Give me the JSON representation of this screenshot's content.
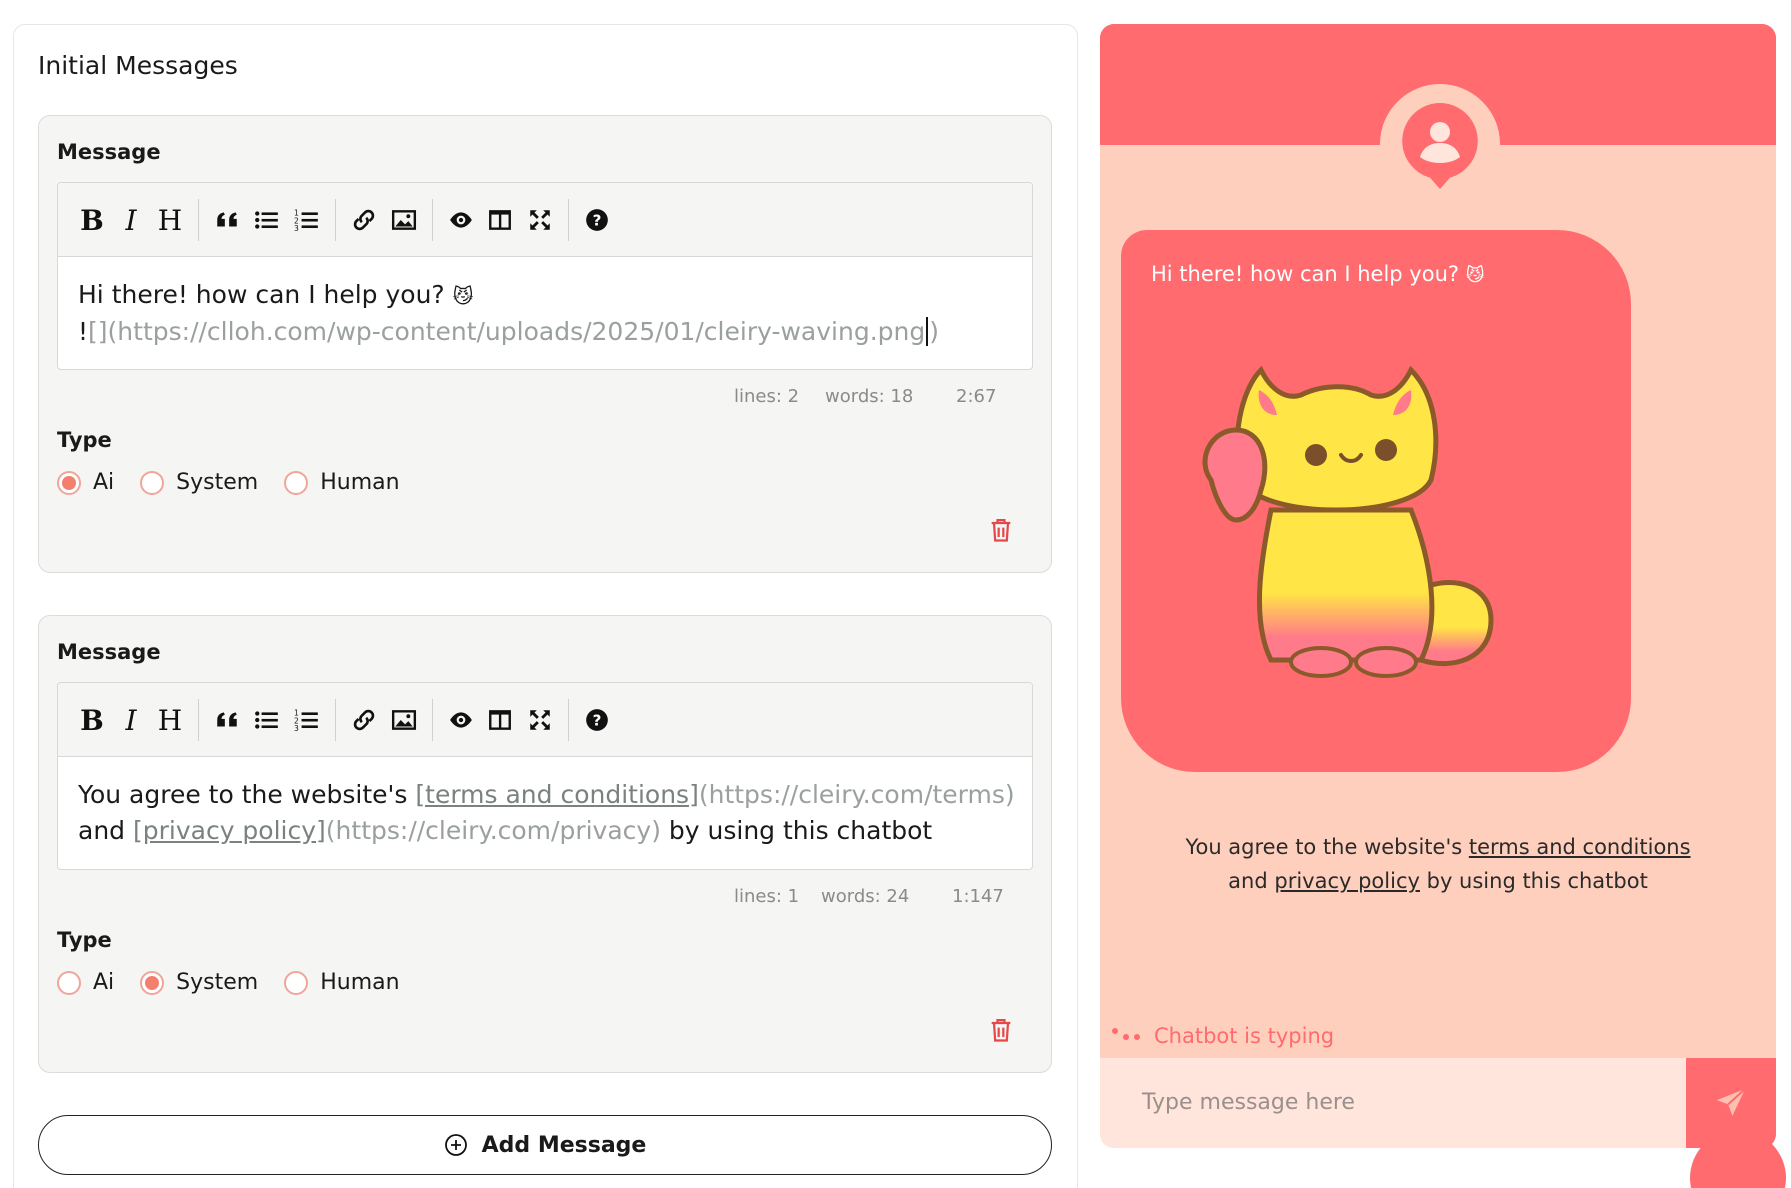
{
  "panel": {
    "title": "Initial Messages"
  },
  "toolbar_icons": [
    "bold-icon",
    "italic-icon",
    "heading-icon",
    "quote-icon",
    "unordered-list-icon",
    "ordered-list-icon",
    "link-icon",
    "image-icon",
    "preview-icon",
    "side-by-side-icon",
    "fullscreen-icon",
    "help-icon"
  ],
  "messages": [
    {
      "label": "Message",
      "line1_text": "Hi there! how can I help you?",
      "line1_emoji": "😼",
      "line2_bang": "!",
      "line2_brackets": "[]",
      "line2_url": "(https://clloh.com/wp-content/uploads/2025/01/cleiry-waving.png",
      "line2_close": ")",
      "status_lines": "lines: 2",
      "status_words": "words: 18",
      "status_cursor": "2:67",
      "type_label": "Type",
      "types": [
        "Ai",
        "System",
        "Human"
      ],
      "selected_type": "Ai"
    },
    {
      "label": "Message",
      "seg1": "You agree to the website's ",
      "link1": "[terms and conditions]",
      "url1": "(https://cleiry.com/terms)",
      "seg2": "and ",
      "link2": "[privacy policy]",
      "url2": "(https://cleiry.com/privacy)",
      "seg3": " by using this chatbot",
      "status_lines": "lines: 1",
      "status_words": "words: 24",
      "status_cursor": "1:147",
      "type_label": "Type",
      "types": [
        "Ai",
        "System",
        "Human"
      ],
      "selected_type": "System"
    }
  ],
  "add_button": {
    "label": "Add Message"
  },
  "chat": {
    "bubble_text": "Hi there! how can I help you?",
    "bubble_emoji": "😼",
    "sys_line1_pre": "You agree to the website's ",
    "sys_terms": "terms and conditions",
    "sys_line2_pre": "and ",
    "sys_privacy": "privacy policy",
    "sys_line2_post": " by using this chatbot",
    "typing_text": "Chatbot is typing",
    "input_placeholder": "Type message here"
  },
  "colors": {
    "accent": "#ff6b6e",
    "chat_bg": "#ffcfbd",
    "radio_selected": "#f37f6e",
    "delete": "#e54848"
  }
}
